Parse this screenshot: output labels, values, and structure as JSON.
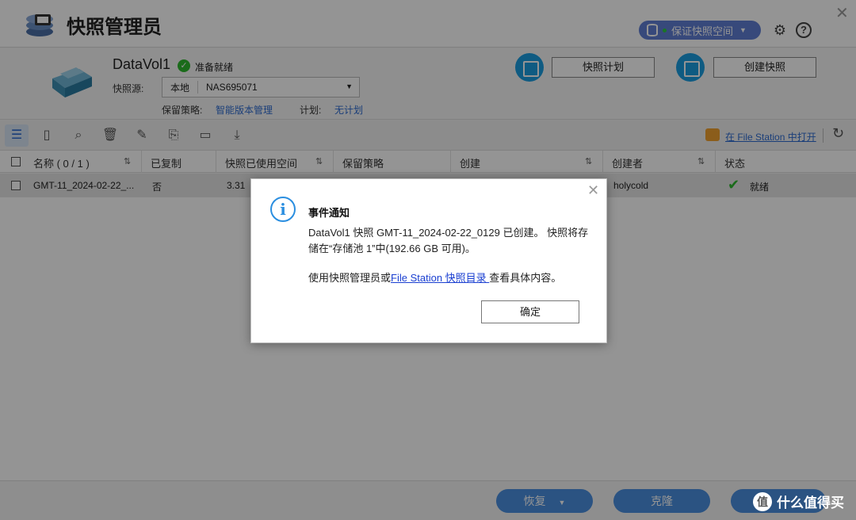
{
  "app": {
    "title": "快照管理员",
    "guarantee_label": "保证快照空间"
  },
  "volume": {
    "name": "DataVol1",
    "status": "准备就绪",
    "source_label": "快照源:",
    "source_location": "本地",
    "source_device": "NAS695071",
    "policy_label": "保留策略:",
    "policy_value": "智能版本管理",
    "plan_label": "计划:",
    "plan_value": "无计划",
    "schedule_button": "快照计划",
    "create_button": "创建快照"
  },
  "toolbar": {
    "filestation_link": "在 File Station 中打开"
  },
  "table": {
    "columns": [
      "名称 ( 0 / 1 )",
      "已复制",
      "快照已使用空间",
      "保留策略",
      "创建",
      "创建者",
      "状态"
    ],
    "rows": [
      {
        "name": "GMT-11_2024-02-22_...",
        "copied": "否",
        "used": "3.31",
        "creator": "holycold",
        "status": "就绪"
      }
    ]
  },
  "bottom": {
    "restore": "恢复",
    "clone": "克隆"
  },
  "dialog": {
    "title": "事件通知",
    "message": "DataVol1 快照 GMT-11_2024-02-22_0129 已创建。 快照将存储在“存储池 1”中(192.66 GB 可用)。",
    "hint_prefix": "使用快照管理员或",
    "hint_link": "File Station 快照目录 ",
    "hint_suffix": "查看具体内容。",
    "ok": "确定"
  },
  "watermark": {
    "text": "什么值得买",
    "badge": "值"
  },
  "colors": {
    "accent": "#2d6bd1",
    "info": "#2a8ee0",
    "success": "#2eb82e"
  }
}
